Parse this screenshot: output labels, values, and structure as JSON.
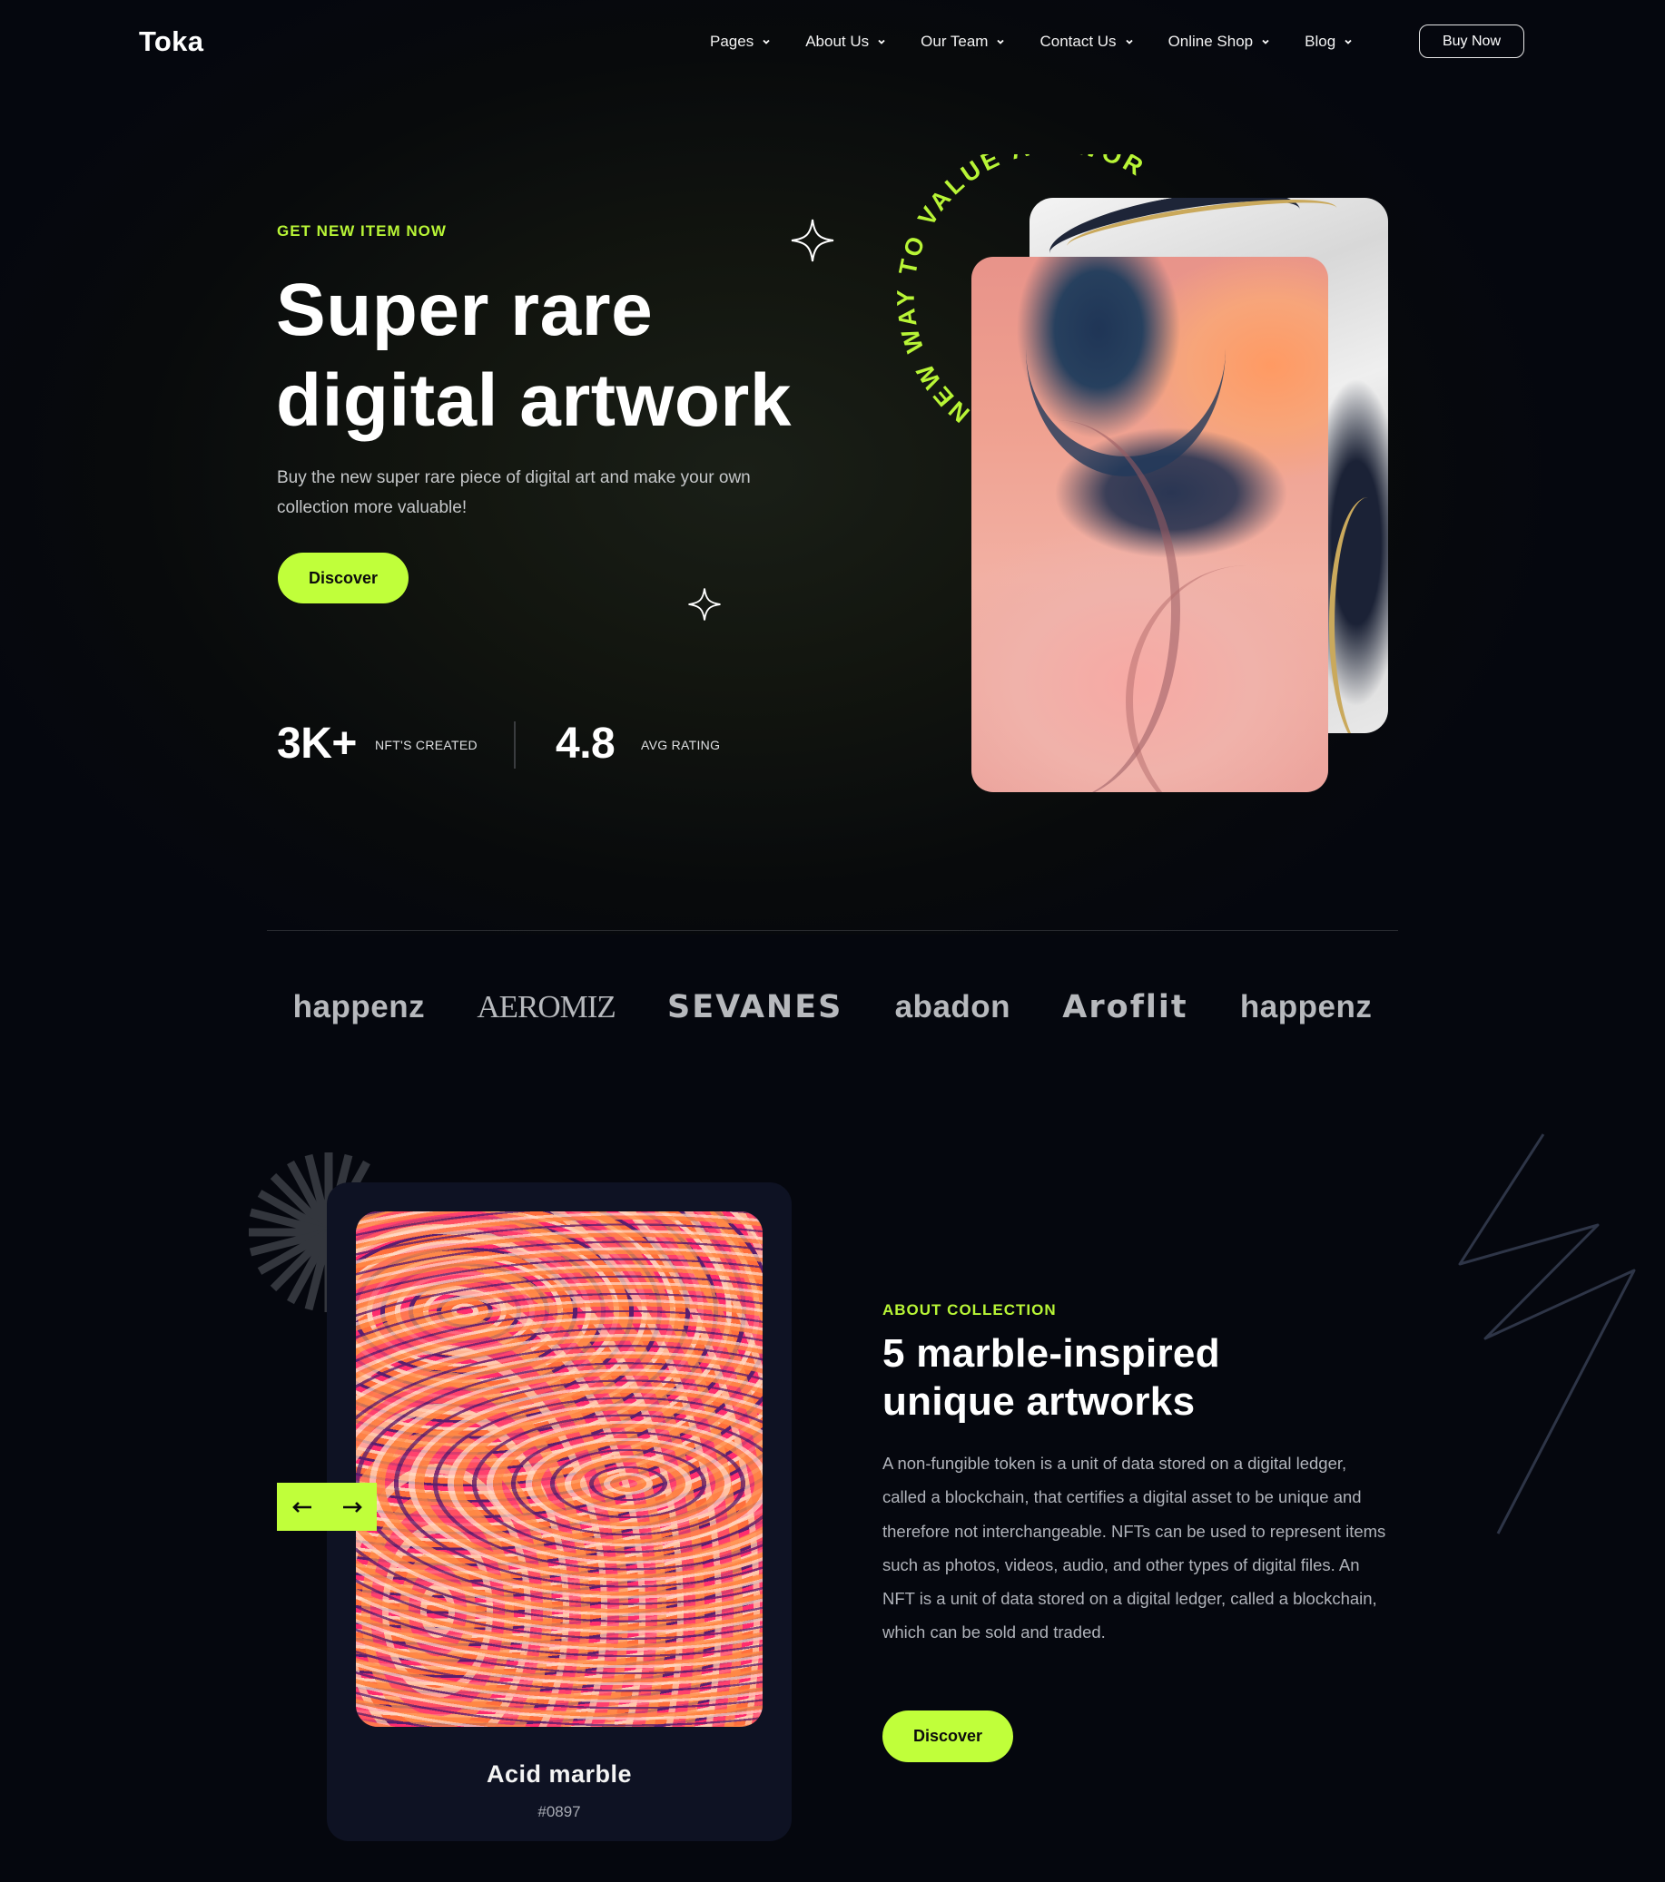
{
  "nav": {
    "logo": "Toka",
    "menu": [
      {
        "label": "Pages"
      },
      {
        "label": "About Us"
      },
      {
        "label": "Our Team"
      },
      {
        "label": "Contact Us"
      },
      {
        "label": "Online Shop"
      },
      {
        "label": "Blog"
      }
    ],
    "cta": "Buy Now"
  },
  "hero": {
    "eyebrow": "GET NEW ITEM NOW",
    "title_line1": "Super rare",
    "title_line2": "digital artwork",
    "description": "Buy the new super rare piece of digital art and make your own collection more valuable!",
    "button": "Discover",
    "curved_text": "NEW WAY TO VALUE ARTWORKS",
    "stats": [
      {
        "value": "3K+",
        "label": "NFT'S CREATED"
      },
      {
        "value": "4.8",
        "label": "AVG RATING"
      }
    ]
  },
  "brands": [
    "happenz",
    "AEROMIZ",
    "SEVANES",
    "abadon",
    "Aroflit",
    "happenz"
  ],
  "collection": {
    "card_title": "Acid marble",
    "card_code": "#0897",
    "eyebrow": "ABOUT COLLECTION",
    "title_line1": "5 marble-inspired",
    "title_line2": "unique artworks",
    "description": "A non-fungible token is a unit of data stored on a digital ledger, called a blockchain, that certifies a digital asset to be unique and therefore not interchangeable. NFTs can be used to represent items such as photos, videos, audio, and other types of digital files. An NFT is a unit of data stored on a digital ledger, called a blockchain, which can be sold and traded.",
    "button": "Discover"
  },
  "colors": {
    "accent": "#c0ff3a",
    "background": "#05070e",
    "card": "#0e1223"
  },
  "icons": {
    "menu_chevron": "chevron-down-icon",
    "prev": "arrow-left-icon",
    "next": "arrow-right-icon",
    "sparkle": "sparkle-icon"
  }
}
